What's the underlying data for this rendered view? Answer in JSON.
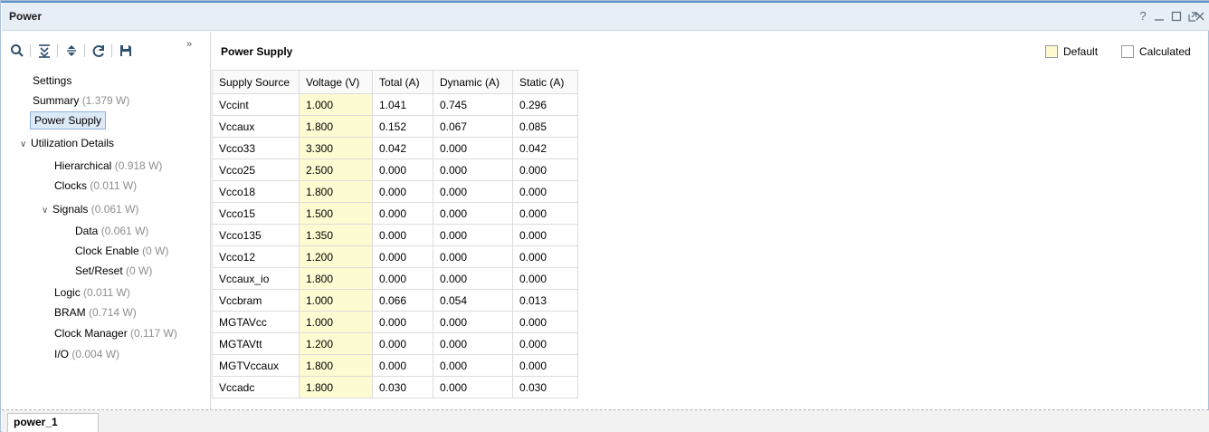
{
  "window": {
    "title": "Power",
    "controls": [
      "help-icon",
      "minimize-icon",
      "restore-icon",
      "float-icon",
      "close-icon"
    ]
  },
  "toolbar": {
    "icons": [
      "search-icon",
      "collapse-all-icon",
      "expand-all-icon",
      "refresh-icon",
      "save-icon",
      "overflow-icon"
    ]
  },
  "nav": {
    "settings": "Settings",
    "summary": {
      "label": "Summary",
      "value": "(1.379 W)"
    },
    "power_supply": "Power Supply",
    "utilization": "Utilization Details",
    "hierarchical": {
      "label": "Hierarchical",
      "value": "(0.918 W)"
    },
    "clocks": {
      "label": "Clocks",
      "value": "(0.011 W)"
    },
    "signals": {
      "label": "Signals",
      "value": "(0.061 W)"
    },
    "data": {
      "label": "Data",
      "value": "(0.061 W)"
    },
    "clock_enable": {
      "label": "Clock Enable",
      "value": "(0 W)"
    },
    "set_reset": {
      "label": "Set/Reset",
      "value": "(0 W)"
    },
    "logic": {
      "label": "Logic",
      "value": "(0.011 W)"
    },
    "bram": {
      "label": "BRAM",
      "value": "(0.714 W)"
    },
    "clock_manager": {
      "label": "Clock Manager",
      "value": "(0.117 W)"
    },
    "io": {
      "label": "I/O",
      "value": "(0.004 W)"
    }
  },
  "panel": {
    "title": "Power Supply",
    "legend_default": "Default",
    "legend_calculated": "Calculated",
    "legend_default_color": "#fdfbd2",
    "legend_calculated_color": "#ffffff"
  },
  "table": {
    "headers": [
      "Supply Source",
      "Voltage (V)",
      "Total (A)",
      "Dynamic (A)",
      "Static (A)"
    ],
    "rows": [
      [
        "Vccint",
        "1.000",
        "1.041",
        "0.745",
        "0.296"
      ],
      [
        "Vccaux",
        "1.800",
        "0.152",
        "0.067",
        "0.085"
      ],
      [
        "Vcco33",
        "3.300",
        "0.042",
        "0.000",
        "0.042"
      ],
      [
        "Vcco25",
        "2.500",
        "0.000",
        "0.000",
        "0.000"
      ],
      [
        "Vcco18",
        "1.800",
        "0.000",
        "0.000",
        "0.000"
      ],
      [
        "Vcco15",
        "1.500",
        "0.000",
        "0.000",
        "0.000"
      ],
      [
        "Vcco135",
        "1.350",
        "0.000",
        "0.000",
        "0.000"
      ],
      [
        "Vcco12",
        "1.200",
        "0.000",
        "0.000",
        "0.000"
      ],
      [
        "Vccaux_io",
        "1.800",
        "0.000",
        "0.000",
        "0.000"
      ],
      [
        "Vccbram",
        "1.000",
        "0.066",
        "0.054",
        "0.013"
      ],
      [
        "MGTAVcc",
        "1.000",
        "0.000",
        "0.000",
        "0.000"
      ],
      [
        "MGTAVtt",
        "1.200",
        "0.000",
        "0.000",
        "0.000"
      ],
      [
        "MGTVccaux",
        "1.800",
        "0.000",
        "0.000",
        "0.000"
      ],
      [
        "Vccadc",
        "1.800",
        "0.030",
        "0.000",
        "0.030"
      ]
    ]
  },
  "tabs": [
    {
      "label": "power_1"
    }
  ]
}
